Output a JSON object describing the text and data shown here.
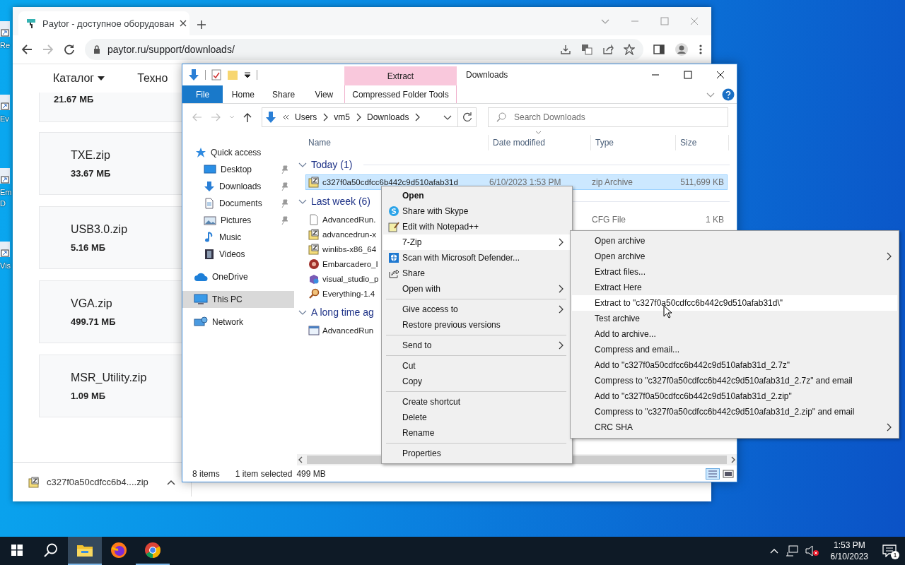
{
  "desktop_icons": [
    {
      "label": "Re"
    },
    {
      "label": "Ev"
    },
    {
      "label": "Em D"
    },
    {
      "label": "Vis"
    }
  ],
  "browser": {
    "tab_title": "Paytor - доступное оборудован",
    "url": "paytor.ru/support/downloads/",
    "nav": [
      {
        "label": "Каталог",
        "dropdown": true
      },
      {
        "label": "Техно",
        "dropdown": false
      }
    ],
    "files": [
      {
        "size": "21.67 МБ"
      },
      {
        "name": "TXE.zip",
        "size": "33.67 МБ"
      },
      {
        "name": "USB3.0.zip",
        "size": "5.16 МБ"
      },
      {
        "name": "VGA.zip",
        "size": "499.71 МБ"
      },
      {
        "name": "MSR_Utility.zip",
        "size": "1.09 МБ"
      }
    ],
    "download": {
      "filename": "c327f0a50cdfcc6b4....zip"
    }
  },
  "explorer": {
    "title": "Downloads",
    "context_tab": {
      "label": "Extract",
      "group": "Compressed Folder Tools"
    },
    "ribbon_tabs": [
      {
        "label": "File",
        "kind": "file"
      },
      {
        "label": "Home",
        "kind": "tab"
      },
      {
        "label": "Share",
        "kind": "tab"
      },
      {
        "label": "View",
        "kind": "tab"
      }
    ],
    "breadcrumb": [
      "Users",
      "vm5",
      "Downloads"
    ],
    "search": {
      "placeholder": "Search Downloads"
    },
    "columns": [
      "Name",
      "Date modified",
      "Type",
      "Size"
    ],
    "nav": [
      {
        "label": "Quick access",
        "kind": "star",
        "selected": false,
        "children": [
          {
            "label": "Desktop",
            "kind": "desktop",
            "pinned": true,
            "selected": false
          },
          {
            "label": "Downloads",
            "kind": "download",
            "pinned": true,
            "selected": false
          },
          {
            "label": "Documents",
            "kind": "documents",
            "pinned": true,
            "selected": false
          },
          {
            "label": "Pictures",
            "kind": "pictures",
            "pinned": true,
            "selected": false
          },
          {
            "label": "Music",
            "kind": "music",
            "pinned": false,
            "selected": false
          },
          {
            "label": "Videos",
            "kind": "videos",
            "pinned": false,
            "selected": false
          }
        ]
      },
      {
        "label": "OneDrive",
        "kind": "cloud",
        "selected": false
      },
      {
        "label": "This PC",
        "kind": "pc",
        "selected": true
      },
      {
        "label": "Network",
        "kind": "network",
        "selected": false
      }
    ],
    "groups": [
      {
        "title": "Today (1)",
        "rows": [
          {
            "name": "c327f0a50cdfcc6b442c9d510afab31d",
            "date": "6/10/2023 1:53 PM",
            "type": "zip Archive",
            "size": "511,699 KB",
            "kind": "zip",
            "selected": true
          }
        ]
      },
      {
        "title": "Last week (6)",
        "rows": [
          {
            "name": "AdvancedRun.",
            "type": "CFG File",
            "size": "1 KB",
            "kind": "file",
            "selected": false
          },
          {
            "name": "advancedrun-x",
            "kind": "zip",
            "selected": false
          },
          {
            "name": "winlibs-x86_64",
            "kind": "zip",
            "selected": false
          },
          {
            "name": "Embarcadero_I",
            "kind": "embarcadero",
            "selected": false
          },
          {
            "name": "visual_studio_p",
            "kind": "vs",
            "selected": false
          },
          {
            "name": "Everything-1.4",
            "kind": "everything",
            "selected": false
          }
        ]
      },
      {
        "title": "A long time ag",
        "rows": [
          {
            "name": "AdvancedRun",
            "kind": "app",
            "selected": false
          }
        ]
      }
    ],
    "status": {
      "items": "8 items",
      "selection": "1 item selected",
      "size": "499 MB"
    }
  },
  "context_menu": {
    "groups": [
      [
        {
          "label": "Open",
          "kind": "default",
          "selected": false,
          "submenu": false
        },
        {
          "label": "Share with Skype",
          "kind": "skype",
          "selected": false,
          "submenu": false
        },
        {
          "label": "Edit with Notepad++",
          "kind": "notepad",
          "selected": false,
          "submenu": false
        },
        {
          "label": "7-Zip",
          "kind": "plain",
          "selected": true,
          "submenu": true
        },
        {
          "label": "Scan with Microsoft Defender...",
          "kind": "defender",
          "selected": false,
          "submenu": false
        },
        {
          "label": "Share",
          "kind": "share",
          "selected": false,
          "submenu": false
        },
        {
          "label": "Open with",
          "kind": "plain",
          "selected": false,
          "submenu": true
        }
      ],
      [
        {
          "label": "Give access to",
          "kind": "plain",
          "selected": false,
          "submenu": true
        },
        {
          "label": "Restore previous versions",
          "kind": "plain",
          "selected": false,
          "submenu": false
        }
      ],
      [
        {
          "label": "Send to",
          "kind": "plain",
          "selected": false,
          "submenu": true
        }
      ],
      [
        {
          "label": "Cut",
          "kind": "plain",
          "selected": false,
          "submenu": false
        },
        {
          "label": "Copy",
          "kind": "plain",
          "selected": false,
          "submenu": false
        }
      ],
      [
        {
          "label": "Create shortcut",
          "kind": "plain",
          "selected": false,
          "submenu": false
        },
        {
          "label": "Delete",
          "kind": "plain",
          "selected": false,
          "submenu": false
        },
        {
          "label": "Rename",
          "kind": "plain",
          "selected": false,
          "submenu": false
        }
      ],
      [
        {
          "label": "Properties",
          "kind": "plain",
          "selected": false,
          "submenu": false
        }
      ]
    ]
  },
  "submenu": {
    "items": [
      {
        "label": "Open archive",
        "selected": false,
        "submenu": false
      },
      {
        "label": "Open archive",
        "selected": false,
        "submenu": true
      },
      {
        "label": "Extract files...",
        "selected": false,
        "submenu": false
      },
      {
        "label": "Extract Here",
        "selected": false,
        "submenu": false
      },
      {
        "label": "Extract to \"c327f0a50cdfcc6b442c9d510afab31d\\\"",
        "selected": true,
        "submenu": false
      },
      {
        "label": "Test archive",
        "selected": false,
        "submenu": false
      },
      {
        "label": "Add to archive...",
        "selected": false,
        "submenu": false
      },
      {
        "label": "Compress and email...",
        "selected": false,
        "submenu": false
      },
      {
        "label": "Add to \"c327f0a50cdfcc6b442c9d510afab31d_2.7z\"",
        "selected": false,
        "submenu": false
      },
      {
        "label": "Compress to \"c327f0a50cdfcc6b442c9d510afab31d_2.7z\" and email",
        "selected": false,
        "submenu": false
      },
      {
        "label": "Add to \"c327f0a50cdfcc6b442c9d510afab31d_2.zip\"",
        "selected": false,
        "submenu": false
      },
      {
        "label": "Compress to \"c327f0a50cdfcc6b442c9d510afab31d_2.zip\" and email",
        "selected": false,
        "submenu": false
      },
      {
        "label": "CRC SHA",
        "selected": false,
        "submenu": true
      }
    ]
  },
  "taskbar": {
    "apps": [
      {
        "kind": "explorer",
        "selected": true,
        "running": true
      },
      {
        "kind": "firefox",
        "selected": false,
        "running": false
      },
      {
        "kind": "chrome",
        "selected": false,
        "running": true
      }
    ],
    "time": "1:53 PM",
    "date": "6/10/2023",
    "notifications": "1"
  }
}
